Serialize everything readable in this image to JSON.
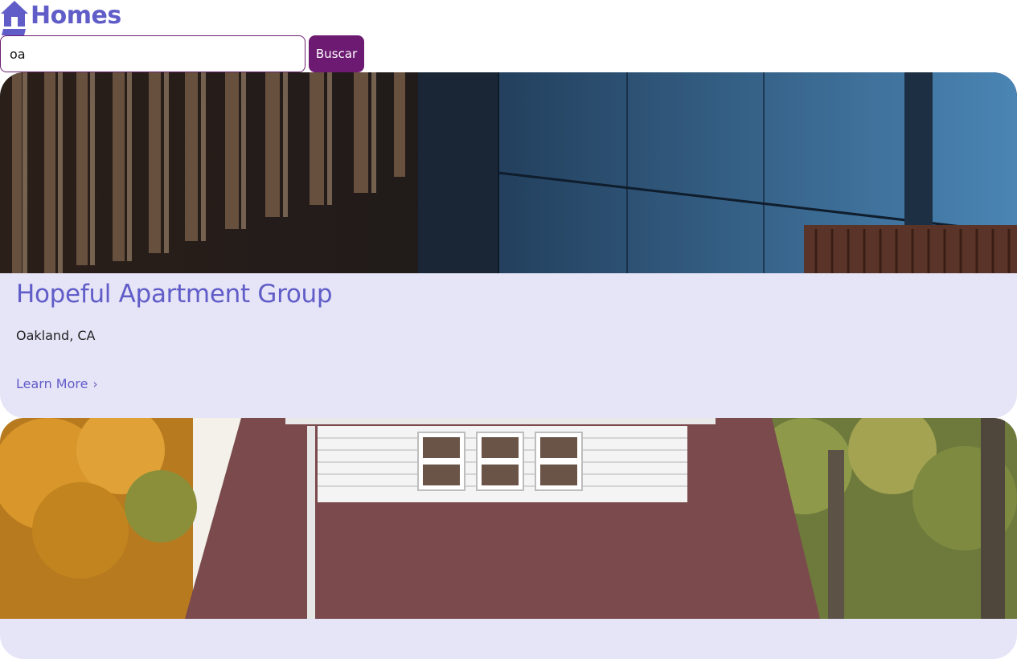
{
  "brand": {
    "name": "Homes",
    "icon": "house-icon",
    "color": "#605dc8"
  },
  "search": {
    "value": "oa",
    "button_label": "Buscar",
    "button_color": "#6d1a72"
  },
  "listings": [
    {
      "title": "Hopeful Apartment Group",
      "location": "Oakland, CA",
      "link_label": "Learn More",
      "link_icon": "›",
      "photo": "modern-building-facade-photo"
    },
    {
      "photo": "brick-house-with-autumn-trees-photo"
    }
  ]
}
